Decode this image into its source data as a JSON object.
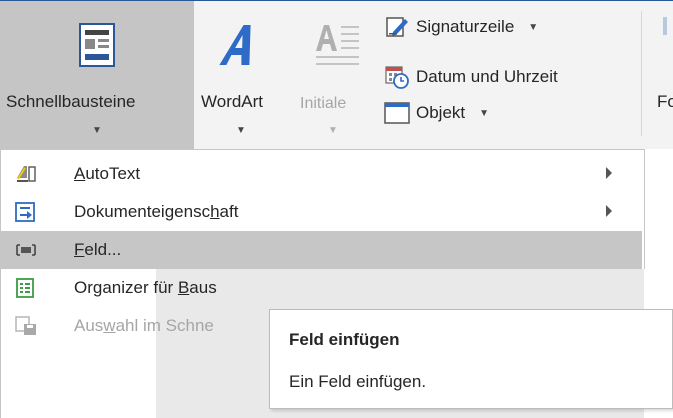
{
  "ribbon": {
    "quickparts_label": "Schnellbausteine",
    "wordart_label": "WordArt",
    "dropcap_label": "Initiale",
    "signature_label": "Signaturzeile",
    "datetime_label": "Datum und Uhrzeit",
    "object_label": "Objekt",
    "cutoff_label": "Fo"
  },
  "menu": {
    "items": [
      {
        "label_pre": "",
        "label_u": "A",
        "label_post": "utoText"
      },
      {
        "label_pre": "Dokumenteigensc",
        "label_u": "h",
        "label_post": "aft"
      },
      {
        "label_pre": "",
        "label_u": "F",
        "label_post": "eld..."
      },
      {
        "label_pre": "Organizer für ",
        "label_u": "B",
        "label_post": "aus"
      },
      {
        "label_pre": "Aus",
        "label_u": "w",
        "label_post": "ahl im Schne"
      }
    ]
  },
  "tooltip": {
    "title": "Feld einfügen",
    "description": "Ein Feld einfügen."
  },
  "colors": {
    "accent": "#2b579a",
    "highlight": "#c6c6c6",
    "wordart_blue": "#2e6bc6"
  }
}
